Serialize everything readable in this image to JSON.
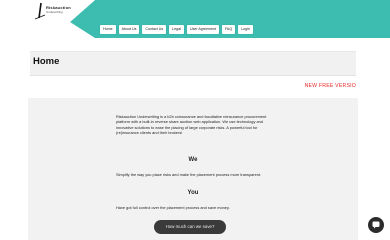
{
  "header": {
    "logo_title": "Riskauction",
    "logo_subtitle": "Underwriting",
    "nav_items": [
      {
        "label": "Home"
      },
      {
        "label": "About Us"
      },
      {
        "label": "Contact Us"
      },
      {
        "label": "Legal"
      },
      {
        "label": "User Agreement"
      },
      {
        "label": "FAQ"
      },
      {
        "label": "Login"
      }
    ],
    "accent_color": "#3dbdb0"
  },
  "page_title": "Home",
  "new_version_banner": "NEW FREE VERSIO",
  "content": {
    "intro": "Riskauction Underwriting is a b2b coinsurance and facultative reinsurance procurement platform with a built-in reverse share auction web application. We use technology and innovative solutions to ease the placing of large corporate risks. A powerful tool for (re)insurance clients and their brokers!",
    "we_heading": "We",
    "we_text": "Simplify the way you place risks and make the placement process more transparent.",
    "you_heading": "You",
    "you_text": "Have got full control over the placement process and save money."
  },
  "cta_label": "How much can we save?"
}
